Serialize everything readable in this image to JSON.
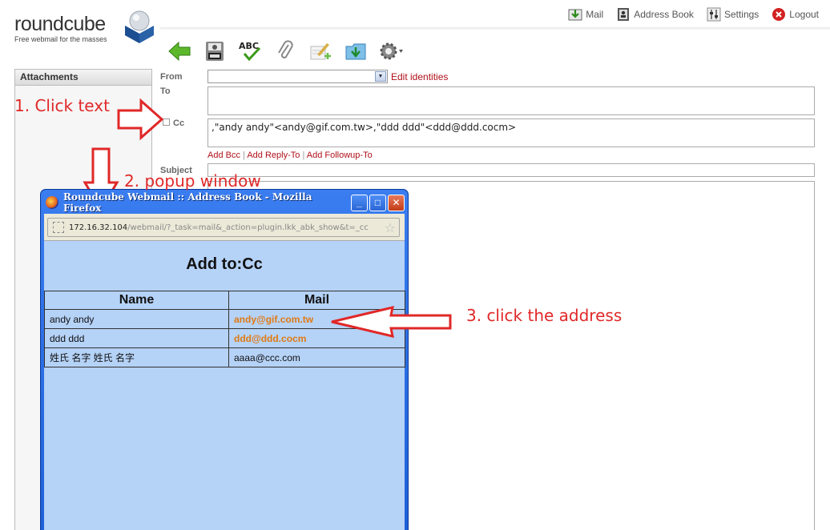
{
  "app": {
    "logo_word": "roundcube",
    "logo_tagline": "Free webmail for the masses"
  },
  "topnav": {
    "mail": "Mail",
    "address_book": "Address Book",
    "settings": "Settings",
    "logout": "Logout"
  },
  "toolbar": {
    "icons": [
      "back-arrow-icon",
      "save-icon",
      "spellcheck-icon",
      "attachment-icon",
      "signature-icon",
      "insert-response-icon",
      "options-gear-icon"
    ]
  },
  "sidebar": {
    "attachments_title": "Attachments"
  },
  "compose": {
    "from_label": "From",
    "from_value": "",
    "edit_identities": "Edit identities",
    "to_label": "To",
    "to_value": "",
    "cc_label": "Cc",
    "cc_value": ",\"andy  andy\"<andy@gif.com.tw>,\"ddd  ddd\"<ddd@ddd.cocm>",
    "add_bcc": "Add Bcc",
    "add_reply_to": "Add Reply-To",
    "add_followup_to": "Add Followup-To",
    "separator": "|",
    "subject_label": "Subject",
    "subject_value": ""
  },
  "annotations": {
    "step1": "1. Click text",
    "step2": "2. popup window",
    "step3": "3. click the address",
    "color": "#e02828"
  },
  "popup": {
    "window_title": "Roundcube Webmail :: Address Book - Mozilla Firefox",
    "url_host": "172.16.32.104",
    "url_path": "/webmail/?_task=mail&_action=plugin.lkk_abk_show&t=_cc",
    "heading": "Add to:Cc",
    "columns": [
      "Name",
      "Mail"
    ],
    "rows": [
      {
        "name": "andy andy",
        "mail": "andy@gif.com.tw",
        "linked": true
      },
      {
        "name": "ddd ddd",
        "mail": "ddd@ddd.cocm",
        "linked": true
      },
      {
        "name": "姓氏 名字 姓氏 名字",
        "mail": "aaaa@ccc.com",
        "linked": false
      }
    ],
    "minimize": "_",
    "maximize": "□",
    "close": "✕"
  }
}
